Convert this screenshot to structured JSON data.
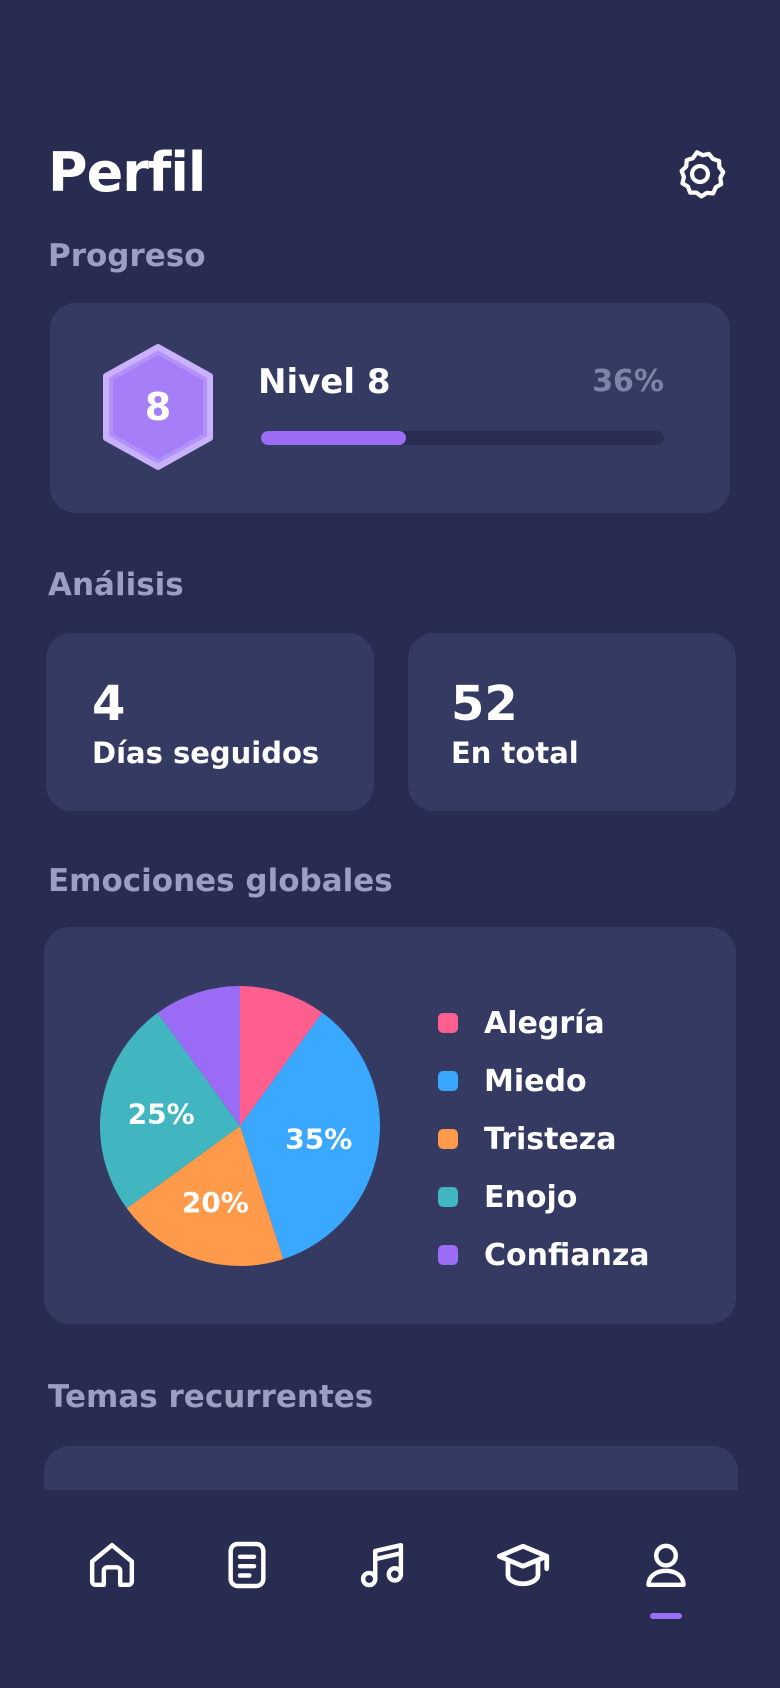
{
  "header": {
    "title": "Perfil",
    "settings_icon": "gear-icon"
  },
  "progress": {
    "section_title": "Progreso",
    "level_number": "8",
    "level_label": "Nivel 8",
    "percent_label": "36%",
    "progress_fraction": 0.36,
    "badge_color": "#a57ef8"
  },
  "analysis": {
    "section_title": "Análisis",
    "stats": [
      {
        "value": "4",
        "label": "Días seguidos"
      },
      {
        "value": "52",
        "label": "En total"
      }
    ]
  },
  "emotions": {
    "section_title": "Emociones globales",
    "legend": [
      {
        "label": "Alegría",
        "color": "#ff5f8f"
      },
      {
        "label": "Miedo",
        "color": "#3aa8ff"
      },
      {
        "label": "Tristeza",
        "color": "#ff9a4a"
      },
      {
        "label": "Enojo",
        "color": "#41b5c0"
      },
      {
        "label": "Confianza",
        "color": "#9a6cf5"
      }
    ]
  },
  "chart_data": {
    "type": "pie",
    "categories": [
      "Alegría",
      "Miedo",
      "Tristeza",
      "Enojo",
      "Confianza"
    ],
    "values": [
      10,
      35,
      20,
      25,
      10
    ],
    "data_labels": [
      "",
      "35%",
      "20%",
      "25%",
      ""
    ],
    "colors": [
      "#ff5f8f",
      "#3aa8ff",
      "#ff9a4a",
      "#41b5c0",
      "#9a6cf5"
    ]
  },
  "themes": {
    "section_title": "Temas recurrentes"
  },
  "nav": {
    "items": [
      {
        "icon": "home-icon"
      },
      {
        "icon": "journal-icon"
      },
      {
        "icon": "music-icon"
      },
      {
        "icon": "graduation-cap-icon"
      },
      {
        "icon": "profile-icon",
        "active": true
      }
    ],
    "active_color": "#9b6cf6"
  }
}
